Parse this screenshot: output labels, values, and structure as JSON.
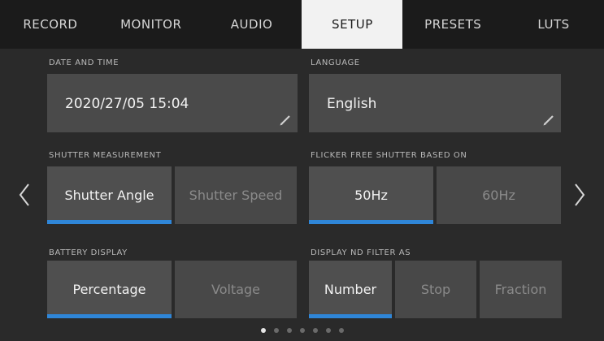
{
  "tabs": [
    {
      "label": "RECORD",
      "active": false
    },
    {
      "label": "MONITOR",
      "active": false
    },
    {
      "label": "AUDIO",
      "active": false
    },
    {
      "label": "SETUP",
      "active": true
    },
    {
      "label": "PRESETS",
      "active": false
    },
    {
      "label": "LUTS",
      "active": false
    }
  ],
  "date_time": {
    "label": "DATE AND TIME",
    "value": "2020/27/05 15:04",
    "icon": "pencil-icon"
  },
  "language": {
    "label": "LANGUAGE",
    "value": "English",
    "icon": "pencil-icon"
  },
  "shutter_measurement": {
    "label": "SHUTTER MEASUREMENT",
    "options": [
      "Shutter Angle",
      "Shutter Speed"
    ],
    "selected": "Shutter Angle"
  },
  "flicker_free": {
    "label": "FLICKER FREE SHUTTER BASED ON",
    "options": [
      "50Hz",
      "60Hz"
    ],
    "selected": "50Hz"
  },
  "battery_display": {
    "label": "BATTERY DISPLAY",
    "options": [
      "Percentage",
      "Voltage"
    ],
    "selected": "Percentage"
  },
  "nd_filter": {
    "label": "DISPLAY ND FILTER AS",
    "options": [
      "Number",
      "Stop",
      "Fraction"
    ],
    "selected": "Number"
  },
  "nav": {
    "prev_icon": "chevron-left-icon",
    "next_icon": "chevron-right-icon"
  },
  "pagination": {
    "total": 7,
    "current": 1
  },
  "colors": {
    "accent": "#2f86d8",
    "tab_active_bg": "#f2f2f2",
    "background": "#2a2a2a"
  }
}
